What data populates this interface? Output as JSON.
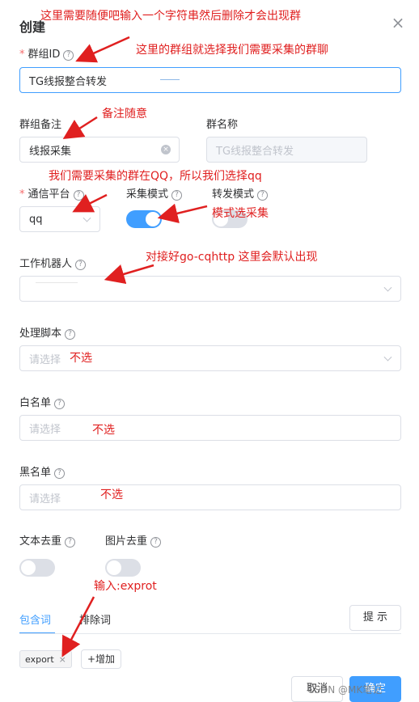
{
  "dialog": {
    "title": "创建",
    "close": "×"
  },
  "group_id": {
    "label": "群组ID",
    "value": "TG线报整合转发",
    "required": "*"
  },
  "group_remark": {
    "label": "群组备注",
    "value": "线报采集"
  },
  "group_name": {
    "label": "群名称",
    "value": "TG线报整合转发"
  },
  "platform": {
    "label": "通信平台",
    "value": "qq",
    "required": "*"
  },
  "collect_mode": {
    "label": "采集模式",
    "on": true
  },
  "forward_mode": {
    "label": "转发模式",
    "on": false
  },
  "robot": {
    "label": "工作机器人"
  },
  "script": {
    "label": "处理脚本",
    "placeholder": "请选择"
  },
  "whitelist": {
    "label": "白名单",
    "placeholder": "请选择"
  },
  "blacklist": {
    "label": "黑名单",
    "placeholder": "请选择"
  },
  "text_dedup": {
    "label": "文本去重",
    "on": false
  },
  "image_dedup": {
    "label": "图片去重",
    "on": false
  },
  "tabs": {
    "include": "包含词",
    "exclude": "排除词",
    "hint_button": "提 示"
  },
  "keywords": [
    {
      "text": "export"
    }
  ],
  "add_button": "+增加",
  "footer": {
    "cancel": "取消",
    "confirm": "确定",
    "watermark": "CSDN @MK笔记"
  },
  "help_glyph": "?",
  "annotations": {
    "a1": "这里需要随便吧输入一个字符串然后删除才会出现群",
    "a2": "这里的群组就选择我们需要采集的群聊",
    "a3": "备注随意",
    "a4": "我们需要采集的群在QQ，所以我们选择qq",
    "a5": "模式选采集",
    "a6": "对接好go-cqhttp 这里会默认出现",
    "a7": "不选",
    "a8": "不选",
    "a9": "不选",
    "a10": "输入:exprot"
  },
  "colors": {
    "primary": "#409eff",
    "annotation": "#e02020",
    "border": "#dcdfe6"
  }
}
